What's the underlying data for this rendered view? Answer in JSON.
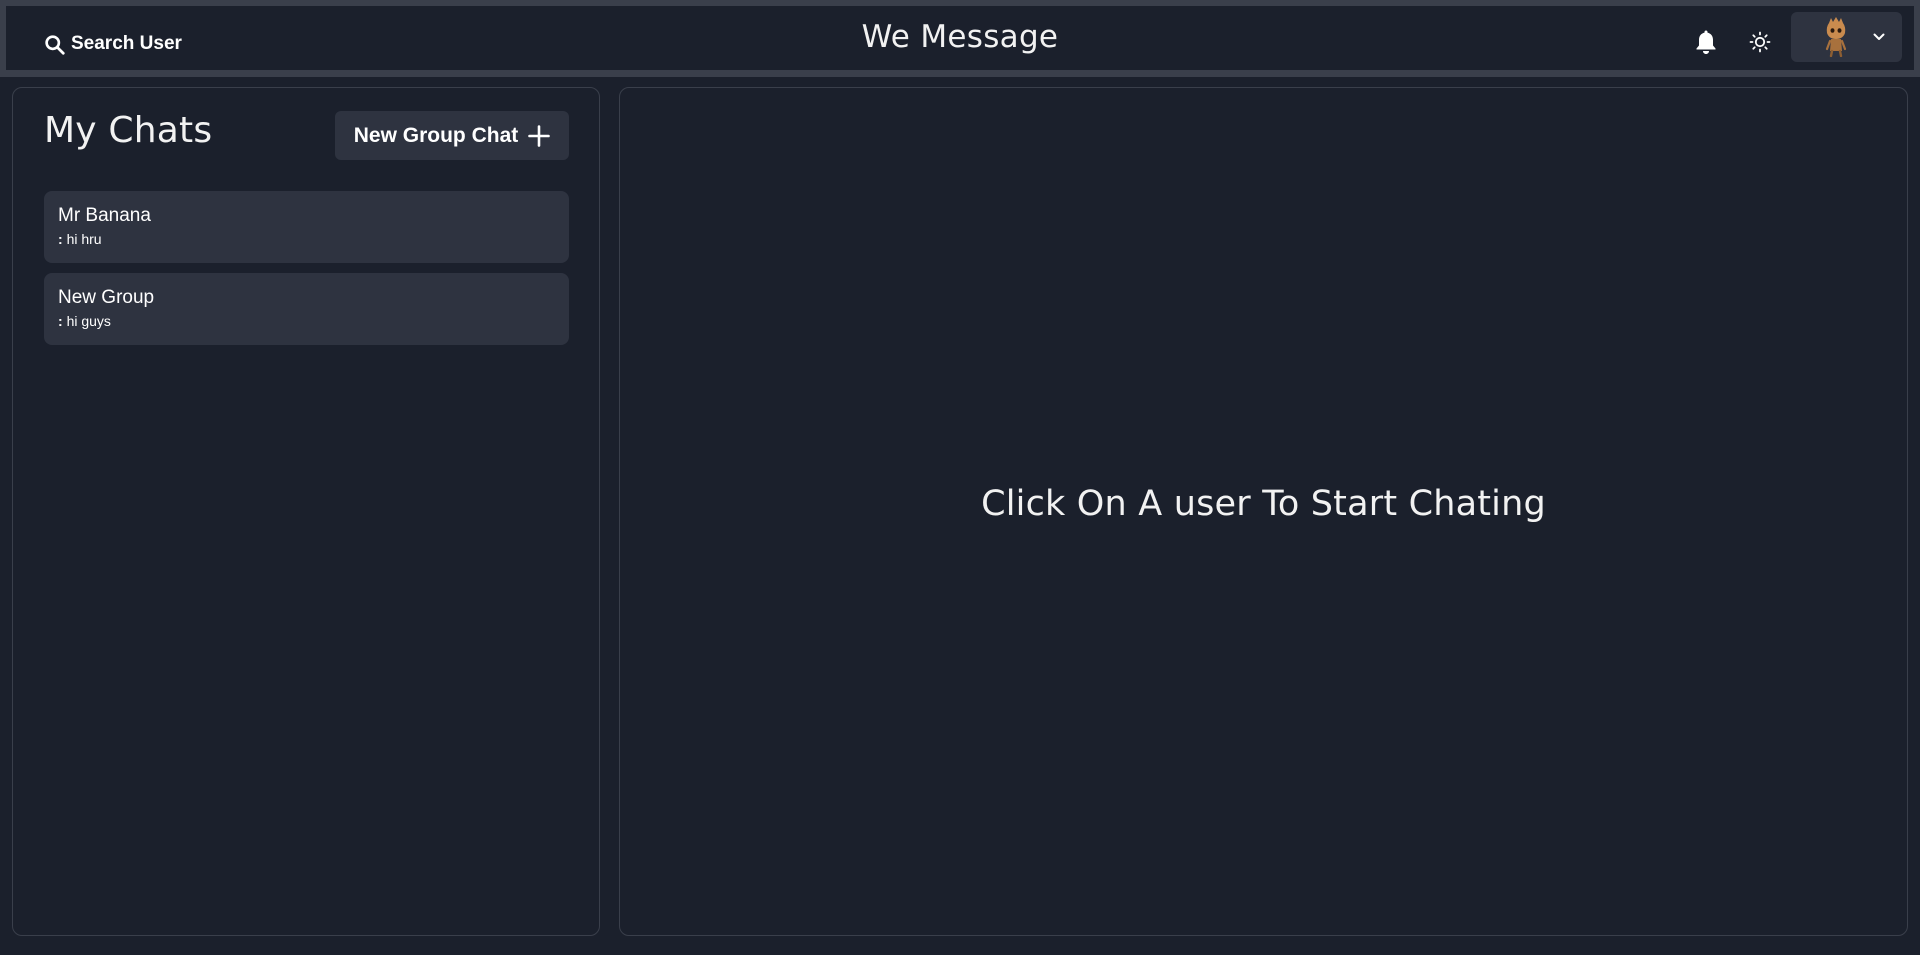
{
  "header": {
    "search_label": "Search User",
    "app_title": "We Message",
    "icons": [
      "search-icon",
      "bell-icon",
      "sun-icon",
      "avatar",
      "chevron-down-icon"
    ]
  },
  "sidebar": {
    "title": "My Chats",
    "new_group_label": "New Group Chat",
    "chats": [
      {
        "name": "Mr Banana",
        "sender": ":",
        "message": "hi hru"
      },
      {
        "name": "New Group",
        "sender": ":",
        "message": "hi guys"
      }
    ]
  },
  "main": {
    "empty_message": "Click On A user To Start Chating"
  },
  "colors": {
    "background": "#1b202c",
    "surface": "#2e3340",
    "border": "#3a3f4b",
    "text": "#ffffff"
  }
}
